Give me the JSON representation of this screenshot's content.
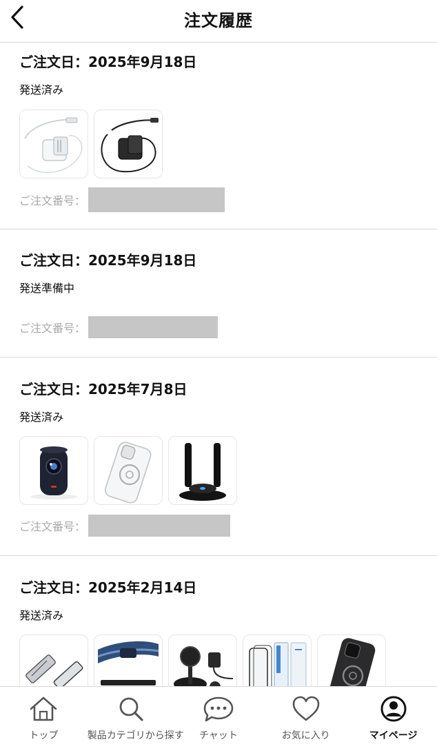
{
  "header": {
    "title": "注文履歴"
  },
  "orders": [
    {
      "date": "ご注文日：2025年9月18日",
      "status": "発送済み",
      "order_no_label": "ご注文番号：",
      "thumbnails": [
        "white-charger-icon",
        "black-charger-icon"
      ]
    },
    {
      "date": "ご注文日：2025年9月18日",
      "status": "発送準備中",
      "order_no_label": "ご注文番号：",
      "thumbnails": []
    },
    {
      "date": "ご注文日：2025年7月8日",
      "status": "発送済み",
      "order_no_label": "ご注文番号：",
      "thumbnails": [
        "projector-icon",
        "clear-phone-case-icon",
        "antenna-stand-icon"
      ]
    },
    {
      "date": "ご注文日：2025年2月14日",
      "status": "発送済み",
      "order_no_label": "ご注文番号：",
      "thumbnails": [
        "phone-stand-icon",
        "blue-strap-icon",
        "charging-stand-icon",
        "screen-protector-icon",
        "black-phone-case-icon"
      ]
    }
  ],
  "tabbar": {
    "items": [
      {
        "label": "トップ",
        "icon": "home-icon"
      },
      {
        "label": "製品カテゴリから探す",
        "icon": "search-icon"
      },
      {
        "label": "チャット",
        "icon": "chat-icon"
      },
      {
        "label": "お気に入り",
        "icon": "heart-icon"
      },
      {
        "label": "マイページ",
        "icon": "account-icon",
        "active": true
      }
    ]
  }
}
